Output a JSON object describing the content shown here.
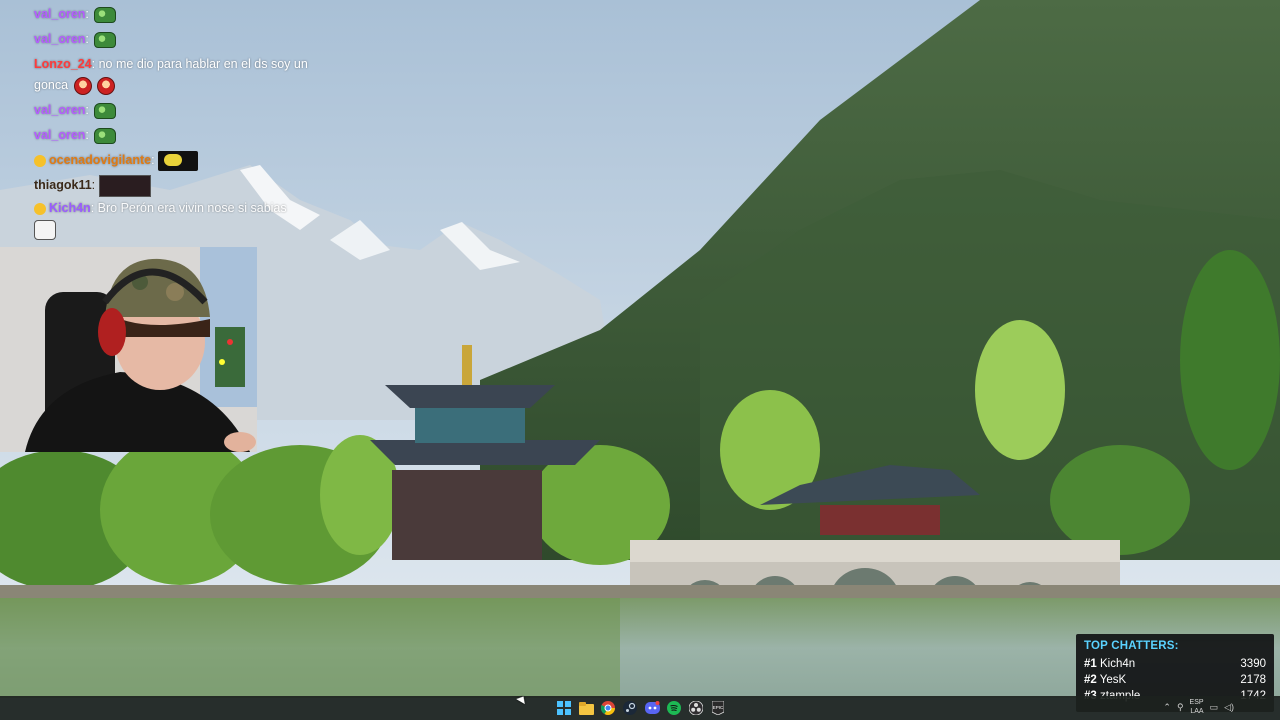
{
  "chat": {
    "messages": [
      {
        "user": "val_oren",
        "text": "",
        "emotes": [
          "frog-emote"
        ]
      },
      {
        "user": "val_oren",
        "text": "",
        "emotes": [
          "frog-emote"
        ]
      },
      {
        "user": "Lonzo_24",
        "text": "no me dio para hablar en el ds soy un gonca",
        "emotes": [
          "sad-face-emote",
          "sad-face-emote"
        ]
      },
      {
        "user": "val_oren",
        "text": "",
        "emotes": [
          "frog-emote"
        ]
      },
      {
        "user": "val_oren",
        "text": "",
        "emotes": [
          "frog-emote"
        ]
      },
      {
        "user": "ocenadovigilante",
        "text": "",
        "emotes": [
          "pepe-glasses-emote"
        ]
      },
      {
        "user": "thiagok11",
        "text": "",
        "emotes": [
          "webcam-clip-emote"
        ]
      },
      {
        "user": "Kich4n",
        "text": "Bro Perón era vivin nose si sabias",
        "emotes": [
          "cat-emote"
        ]
      }
    ]
  },
  "top_chatters": {
    "title": "TOP CHATTERS:",
    "rows": [
      {
        "rank": "#1",
        "name": "Kich4n",
        "count": "3390"
      },
      {
        "rank": "#2",
        "name": "YesK",
        "count": "2178"
      },
      {
        "rank": "#3",
        "name": "ztample",
        "count": "1742"
      }
    ]
  },
  "taskbar": {
    "apps": [
      "start-icon",
      "file-explorer-icon",
      "chrome-icon",
      "steam-icon",
      "discord-icon",
      "spotify-icon",
      "obs-icon",
      "epic-games-icon"
    ],
    "tray": {
      "lang": "ESP",
      "lang_sub": "LAA"
    }
  },
  "colors": {
    "chatters_title": "#5ad2ff",
    "val_oren": "#b55cff",
    "lonzo": "#ff3b3b",
    "kich": "#9b5cff"
  }
}
